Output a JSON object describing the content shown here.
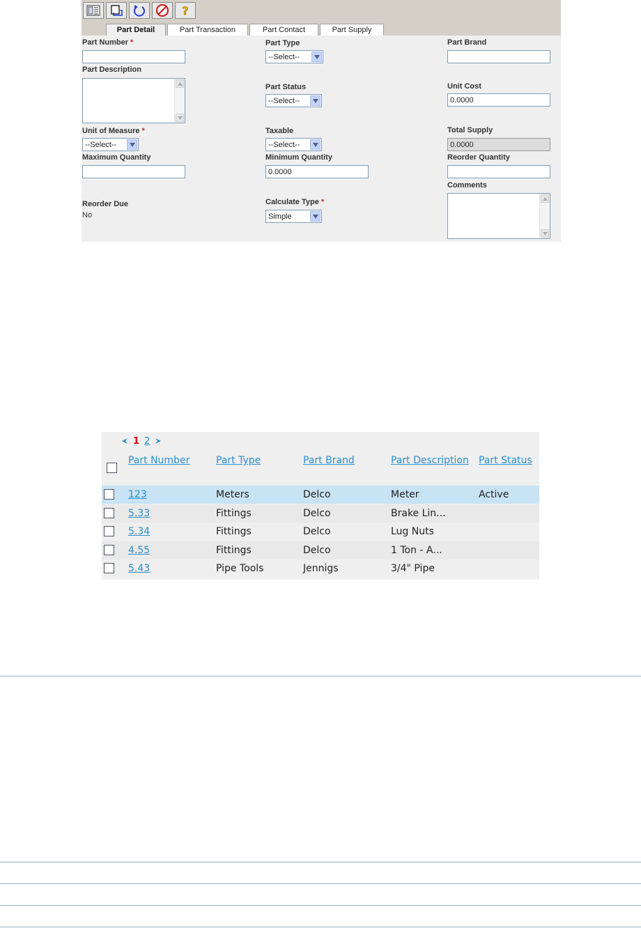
{
  "toolbar": {
    "buttons": [
      {
        "name": "list-view",
        "icon": "list-icon"
      },
      {
        "name": "save",
        "icon": "save-icon"
      },
      {
        "name": "refresh",
        "icon": "refresh-icon"
      },
      {
        "name": "cancel",
        "icon": "cancel-icon"
      },
      {
        "name": "help",
        "icon": "help-icon"
      }
    ]
  },
  "tabs": [
    "Part Detail",
    "Part Transaction",
    "Part Contact",
    "Part Supply"
  ],
  "active_tab": "Part Detail",
  "form": {
    "part_number": {
      "label": "Part Number",
      "required_mark": "*",
      "value": ""
    },
    "part_type": {
      "label": "Part Type",
      "value": "--Select--"
    },
    "part_brand": {
      "label": "Part Brand",
      "value": ""
    },
    "part_description": {
      "label": "Part Description",
      "value": ""
    },
    "part_status": {
      "label": "Part Status",
      "value": "--Select--"
    },
    "unit_cost": {
      "label": "Unit Cost",
      "value": "0.0000"
    },
    "unit_of_measure": {
      "label": "Unit of Measure",
      "required_mark": "*",
      "value": "--Select--"
    },
    "taxable": {
      "label": "Taxable",
      "value": "--Select--"
    },
    "total_supply": {
      "label": "Total Supply",
      "value": "0.0000"
    },
    "maximum_quantity": {
      "label": "Maximum Quantity",
      "value": ""
    },
    "minimum_quantity": {
      "label": "Minimum Quantity",
      "value": "0.0000"
    },
    "reorder_quantity": {
      "label": "Reorder Quantity",
      "value": ""
    },
    "comments": {
      "label": "Comments",
      "value": ""
    },
    "reorder_due": {
      "label": "Reorder Due",
      "value": "No"
    },
    "calculate_type": {
      "label": "Calculate Type",
      "required_mark": "*",
      "value": "Simple"
    }
  },
  "grid": {
    "pager": {
      "current": "1",
      "other": "2"
    },
    "headers": [
      "Part Number",
      "Part Type",
      "Part Brand",
      "Part Description",
      "Part Status"
    ],
    "rows": [
      {
        "part_number": "123",
        "part_type": "Meters",
        "part_brand": "Delco",
        "part_description": "Meter",
        "part_status": "Active",
        "highlighted": true
      },
      {
        "part_number": "5.33",
        "part_type": "Fittings",
        "part_brand": "Delco",
        "part_description": "Brake Lin...",
        "part_status": "",
        "highlighted": false
      },
      {
        "part_number": "5.34",
        "part_type": "Fittings",
        "part_brand": "Delco",
        "part_description": "Lug Nuts",
        "part_status": "",
        "highlighted": false
      },
      {
        "part_number": "4.55",
        "part_type": "Fittings",
        "part_brand": "Delco",
        "part_description": "1 Ton - A...",
        "part_status": "",
        "highlighted": false
      },
      {
        "part_number": "5.43",
        "part_type": "Pipe Tools",
        "part_brand": "Jennigs",
        "part_description": "3/4\" Pipe",
        "part_status": "",
        "highlighted": false
      }
    ]
  },
  "colors": {
    "panel_bg": "#efefef",
    "toolbar_bg": "#d4d0c8",
    "row_highlight": "#c7e3f4",
    "link": "#2e8fc8",
    "required": "#d02020",
    "pager_current": "#d00000",
    "rule": "#8fb3c6"
  }
}
